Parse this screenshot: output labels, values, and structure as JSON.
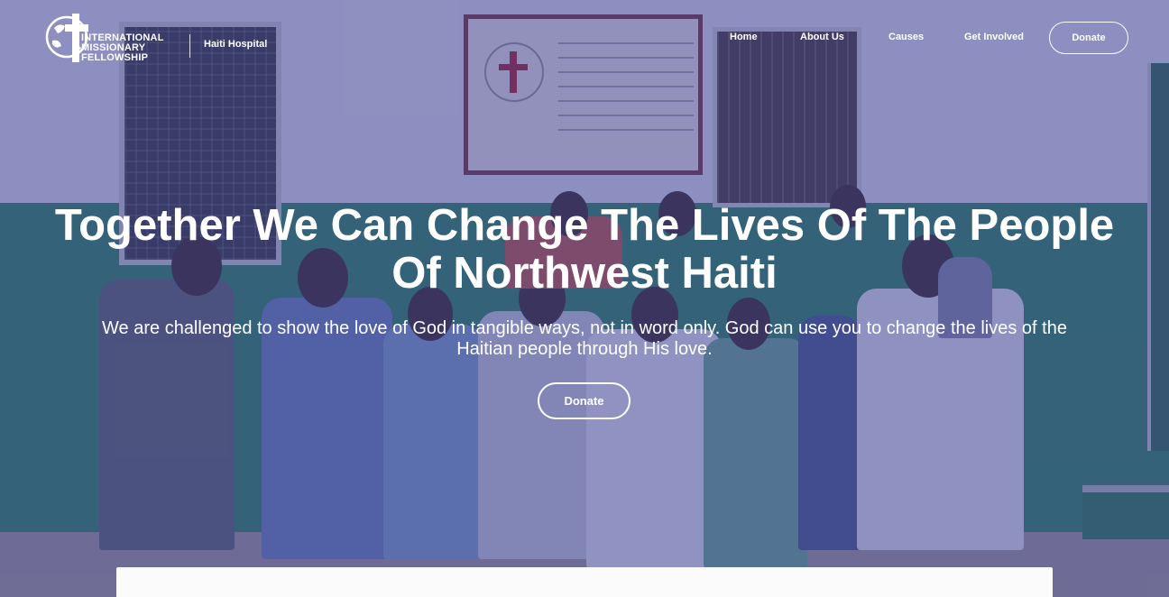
{
  "logo": {
    "line1": "INTERNATIONAL",
    "line2": "MISSIONARY",
    "line3": "FELLOWSHIP",
    "icon": "globe-cross-icon"
  },
  "site_name": "Haiti Hospital",
  "nav": {
    "items": [
      {
        "label": "Home"
      },
      {
        "label": "About Us"
      },
      {
        "label": "Causes"
      },
      {
        "label": "Get Involved"
      }
    ],
    "donate_label": "Donate"
  },
  "hero": {
    "headline": "Together We Can Change The Lives Of The People Of Northwest Haiti",
    "subtext": "We are challenged to show the love of God in tangible ways, not in word only. God can use you to change the lives of the Haitian people through His love.",
    "donate_label": "Donate"
  },
  "colors": {
    "overlay": "#3a3e96",
    "text": "#ffffff",
    "wall_green": "#2f8a58"
  }
}
